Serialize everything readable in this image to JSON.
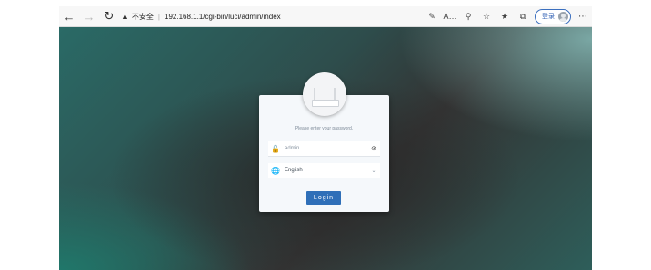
{
  "browser": {
    "security_label": "不安全",
    "url": "192.168.1.1/cgi-bin/luci/admin/index",
    "signin_label": "登录"
  },
  "login": {
    "hint": "Please enter your password.",
    "username_value": "admin",
    "language_value": "English",
    "login_button": "Login"
  }
}
